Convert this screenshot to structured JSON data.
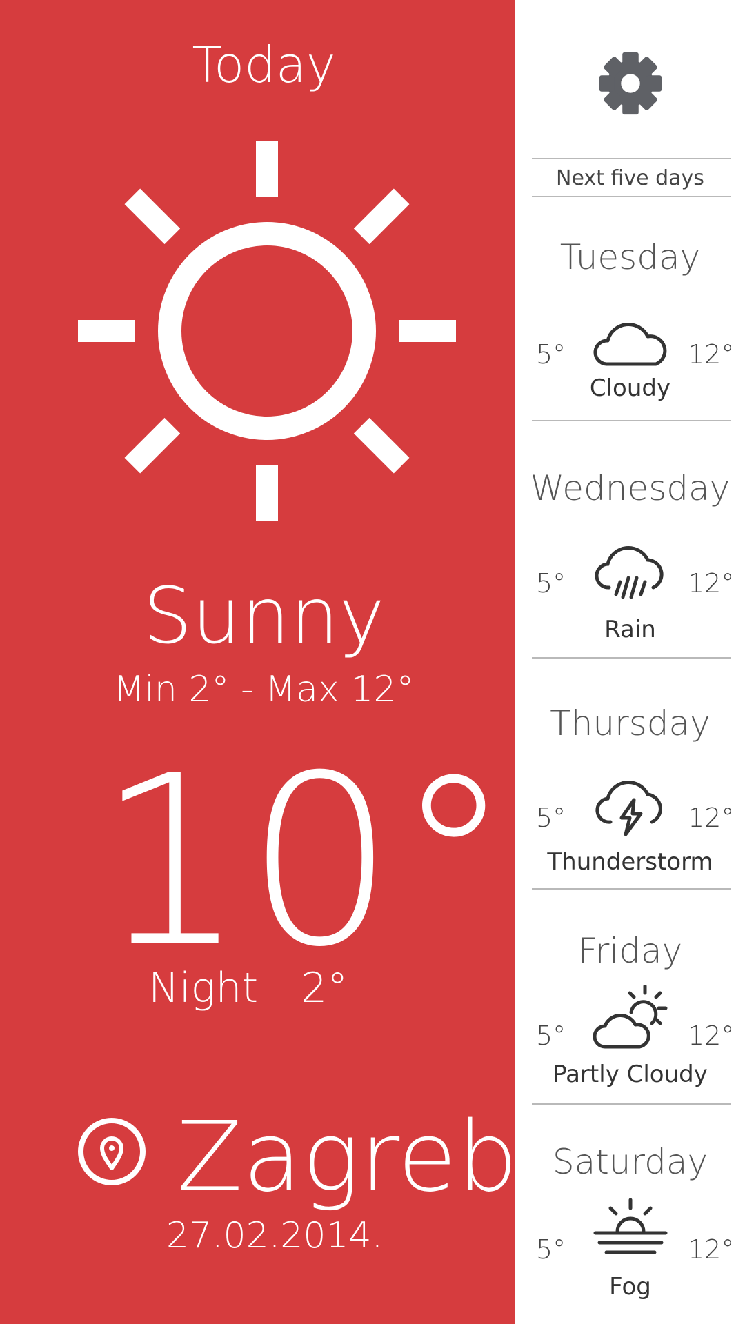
{
  "today": {
    "title": "Today",
    "condition": "Sunny",
    "min_max": "Min 2°  -  Max 12°",
    "temperature": "10°",
    "night_label": "Night",
    "night_temp": "2°",
    "city": "Zagreb",
    "date": "27.02.2014.",
    "icon": "sun-icon",
    "location_icon": "map-pin-icon"
  },
  "sidebar": {
    "settings_icon": "gear-icon",
    "header": "Next five days",
    "days": [
      {
        "name": "Tuesday",
        "min": "5°",
        "max": "12°",
        "condition": "Cloudy",
        "icon": "cloud-icon"
      },
      {
        "name": "Wednesday",
        "min": "5°",
        "max": "12°",
        "condition": "Rain",
        "icon": "rain-icon"
      },
      {
        "name": "Thursday",
        "min": "5°",
        "max": "12°",
        "condition": "Thunderstorm",
        "icon": "thunderstorm-icon"
      },
      {
        "name": "Friday",
        "min": "5°",
        "max": "12°",
        "condition": "Partly Cloudy",
        "icon": "partly-cloudy-icon"
      },
      {
        "name": "Saturday",
        "min": "5°",
        "max": "12°",
        "condition": "Fog",
        "icon": "fog-icon"
      }
    ]
  },
  "colors": {
    "accent": "#d63c3e",
    "icon_gray": "#5f6166",
    "divider": "#b9b9b9"
  }
}
